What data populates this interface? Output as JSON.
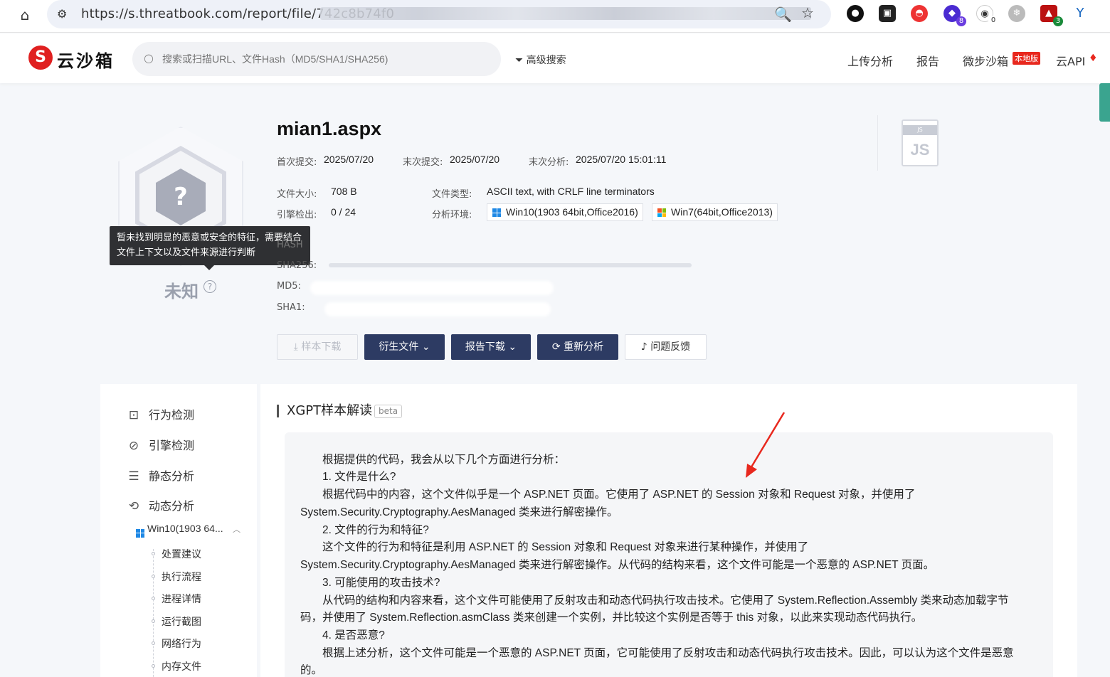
{
  "browser": {
    "url": "https://s.threatbook.com/report/file/742c8b74f0"
  },
  "header": {
    "logo_text": "云沙箱",
    "logo_mark": "S",
    "search_placeholder": "搜索或扫描URL、文件Hash（MD5/SHA1/SHA256)",
    "advanced_search": "高级搜索",
    "nav": [
      "上传分析",
      "报告",
      "微步沙箱",
      "云API"
    ],
    "local_badge": "本地版"
  },
  "summary": {
    "verdict": "未知",
    "tooltip": "暂未找到明显的恶意或安全的特征，需要结合文件上下文以及文件来源进行判断",
    "filename": "mian1.aspx",
    "first_submit_label": "首次提交:",
    "first_submit": "2025/07/20",
    "last_submit_label": "末次提交:",
    "last_submit": "2025/07/20",
    "last_analysis_label": "末次分析:",
    "last_analysis": "2025/07/20 15:01:11",
    "size_label": "文件大小:",
    "size": "708 B",
    "engine_label": "引擎检出:",
    "engine": "0 / 24",
    "type_label": "文件类型:",
    "type": "ASCII text, with CRLF line terminators",
    "env_label": "分析环境:",
    "envs": [
      "Win10(1903 64bit,Office2016)",
      "Win7(64bit,Office2013)"
    ],
    "hash_label": "HASH",
    "sha256_label": "SHA256:",
    "md5_label": "MD5:",
    "sha1_label": "SHA1:",
    "filetype_icon": "JS"
  },
  "actions": {
    "download_sample": "样本下载",
    "derived_files": "衍生文件",
    "report_download": "报告下载",
    "reanalyze": "重新分析",
    "feedback": "问题反馈"
  },
  "sidebar": {
    "items": [
      "行为检测",
      "引擎检测",
      "静态分析",
      "动态分析"
    ],
    "env_short": "Win10(1903 64...",
    "sub_items": [
      "处置建议",
      "执行流程",
      "进程详情",
      "运行截图",
      "网络行为",
      "内存文件"
    ]
  },
  "gpt": {
    "title": "XGPT样本解读",
    "badge": "beta",
    "lines": [
      "根据提供的代码，我会从以下几个方面进行分析：",
      "1. 文件是什么?",
      "根据代码中的内容，这个文件似乎是一个 ASP.NET 页面。它使用了 ASP.NET 的 Session 对象和 Request 对象，并使用了",
      "System.Security.Cryptography.AesManaged 类来进行解密操作。",
      "2. 文件的行为和特征?",
      "这个文件的行为和特征是利用 ASP.NET 的 Session 对象和 Request 对象来进行某种操作，并使用了",
      "System.Security.Cryptography.AesManaged 类来进行解密操作。从代码的结构来看，这个文件可能是一个恶意的 ASP.NET 页面。",
      "3. 可能使用的攻击技术?",
      "从代码的结构和内容来看，这个文件可能使用了反射攻击和动态代码执行攻击技术。它使用了 System.Reflection.Assembly 类来动态加载字节",
      "码，并使用了 System.Reflection.asmClass 类来创建一个实例，并比较这个实例是否等于 this 对象，以此来实现动态代码执行。",
      "4. 是否恶意?",
      "根据上述分析，这个文件可能是一个恶意的 ASP.NET 页面，它可能使用了反射攻击和动态代码执行攻击技术。因此，可以认为这个文件是恶意",
      "的。"
    ]
  },
  "colors": {
    "brand_red": "#e02020",
    "button_dark": "#2d3b63",
    "arrow_red": "#e8281e",
    "side_tab": "#3aa48f"
  }
}
